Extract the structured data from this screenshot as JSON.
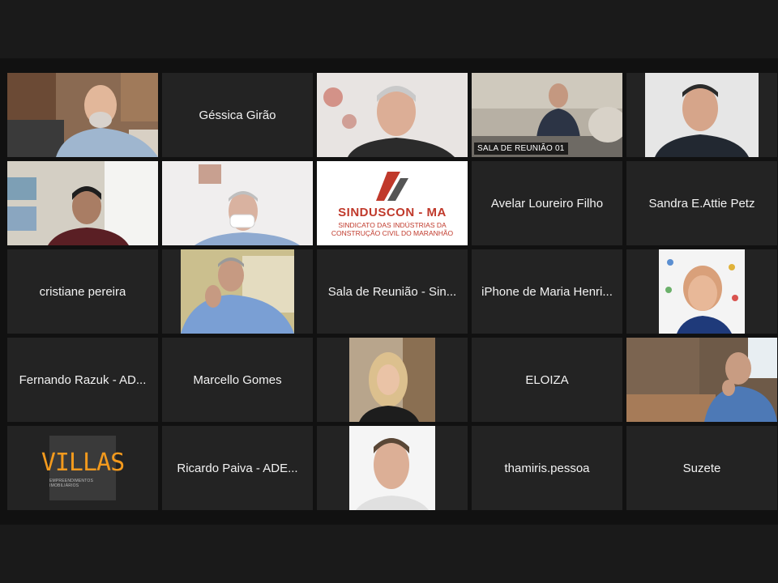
{
  "meeting": {
    "participants": [
      {
        "name": "",
        "video": true,
        "icon": "man-bearded-glasses-icon"
      },
      {
        "name": "Géssica Girão",
        "video": false
      },
      {
        "name": "",
        "video": true,
        "icon": "man-grey-hair-icon"
      },
      {
        "name": "SALA DE REUNIÃO 01",
        "video": true,
        "active_speaker": true,
        "icon": "meeting-room-icon"
      },
      {
        "name": "",
        "video": true,
        "icon": "man-dark-hair-icon"
      },
      {
        "name": "",
        "video": true,
        "icon": "man-headset-icon"
      },
      {
        "name": "",
        "video": true,
        "icon": "man-mask-icon"
      },
      {
        "name": "",
        "video": true,
        "icon": "sinduscon-logo-icon",
        "logo_title": "SINDUSCON - MA",
        "logo_subtitle_1": "SINDICATO DAS INDÚSTRIAS DA",
        "logo_subtitle_2": "CONSTRUÇÃO CIVIL DO MARANHÃO"
      },
      {
        "name": "Avelar Loureiro Filho",
        "video": false
      },
      {
        "name": "Sandra E.Attie Petz",
        "video": false
      },
      {
        "name": "cristiane pereira",
        "video": false
      },
      {
        "name": "",
        "video": true,
        "icon": "man-thinking-icon"
      },
      {
        "name": "Sala de Reunião - Sin...",
        "video": false
      },
      {
        "name": "iPhone de Maria Henri...",
        "video": false
      },
      {
        "name": "",
        "video": true,
        "icon": "woman-smiling-icon"
      },
      {
        "name": "Fernando Razuk - AD...",
        "video": false
      },
      {
        "name": "Marcello Gomes",
        "video": false
      },
      {
        "name": "",
        "video": true,
        "icon": "woman-blonde-icon"
      },
      {
        "name": "ELOIZA",
        "video": false
      },
      {
        "name": "",
        "video": true,
        "icon": "man-on-phone-icon"
      },
      {
        "name": "",
        "video": true,
        "icon": "villas-logo-icon",
        "logo_word": "VILLAS",
        "logo_sub": "EMPREENDIMENTOS IMOBILIÁRIOS"
      },
      {
        "name": "Ricardo Paiva  - ADE...",
        "video": false
      },
      {
        "name": "",
        "video": true,
        "icon": "man-portrait-icon"
      },
      {
        "name": "thamiris.pessoa",
        "video": false
      },
      {
        "name": "Suzete",
        "video": false
      }
    ]
  },
  "colors": {
    "tile_background": "#232323",
    "page_background": "#1a1a1a",
    "active_speaker_border": "#a8d068",
    "sinduscon_red": "#c0392b",
    "villas_orange": "#f39a1d"
  }
}
